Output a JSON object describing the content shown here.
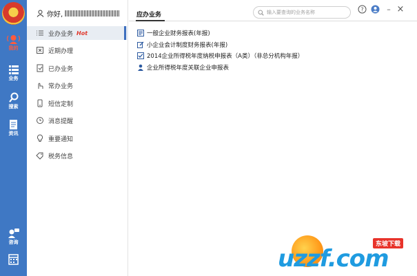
{
  "rail": {
    "items": [
      {
        "label": "我的",
        "icon": "my-icon",
        "active": true
      },
      {
        "label": "业务",
        "icon": "list-icon"
      },
      {
        "label": "搜索",
        "icon": "search-icon"
      },
      {
        "label": "资讯",
        "icon": "news-icon"
      },
      {
        "label": "咨询",
        "icon": "chat-icon"
      },
      {
        "label": "",
        "icon": "calendar-icon"
      }
    ],
    "accent": "#3f78c4",
    "active_color": "#ff5a3c"
  },
  "menu": {
    "greeting": "你好,",
    "items": [
      {
        "label": "业办业务",
        "badge": "Hot",
        "icon": "list-lines-icon",
        "active": true
      },
      {
        "label": "近期办理",
        "icon": "history-icon"
      },
      {
        "label": "已办业务",
        "icon": "done-doc-icon"
      },
      {
        "label": "常办业务",
        "icon": "hand-icon"
      },
      {
        "label": "短信定制",
        "icon": "phone-icon"
      },
      {
        "label": "消息提醒",
        "icon": "clock-icon"
      },
      {
        "label": "重要通知",
        "icon": "bulb-icon"
      },
      {
        "label": "税务信息",
        "icon": "tag-icon"
      }
    ]
  },
  "main": {
    "tab_title": "应办业务",
    "search_placeholder": "输入要查询的业务名称",
    "tasks": [
      {
        "label": "一般企业财务报表(年报)",
        "icon": "form-icon"
      },
      {
        "label": "小企业会计制度财务报表(年报)",
        "icon": "edit-icon"
      },
      {
        "label": "2014企业所得税年度纳税申报表（A类）（非总分机构年报）",
        "icon": "check-icon"
      },
      {
        "label": "企业所得税年度关联企业申报表",
        "icon": "person-icon"
      }
    ]
  },
  "window": {
    "help": "?",
    "minimize": "–",
    "close": "×"
  },
  "watermark": {
    "text": "uzzf.com",
    "badge": "东坡下载"
  }
}
